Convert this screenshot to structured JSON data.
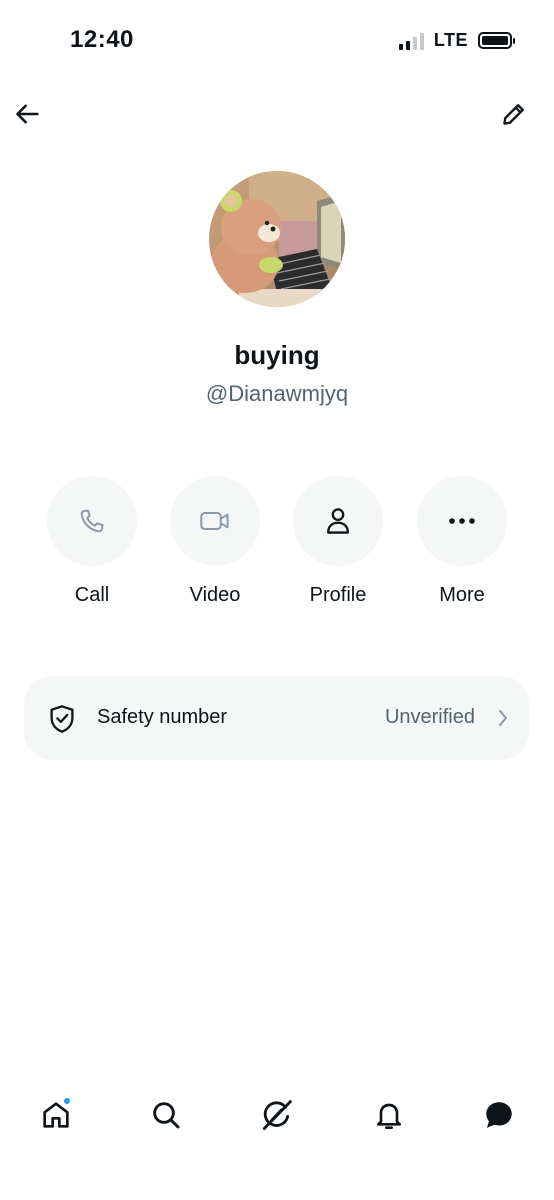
{
  "status_bar": {
    "time": "12:40",
    "network": "LTE"
  },
  "header": {
    "back_icon": "arrow-left-icon",
    "edit_icon": "pencil-icon"
  },
  "profile": {
    "display_name": "buying",
    "handle": "@Dianawmjyq"
  },
  "actions": [
    {
      "label": "Call",
      "icon": "phone-icon"
    },
    {
      "label": "Video",
      "icon": "video-camera-icon"
    },
    {
      "label": "Profile",
      "icon": "person-icon"
    },
    {
      "label": "More",
      "icon": "more-dots-icon"
    }
  ],
  "safety": {
    "label": "Safety number",
    "status": "Unverified"
  },
  "tab_bar": {
    "items": [
      "home-icon",
      "search-icon",
      "grok-icon",
      "bell-icon",
      "messages-icon"
    ],
    "home_has_notification": true
  },
  "colors": {
    "accent": "#1d9bf0",
    "text_primary": "#0f1419",
    "text_secondary": "#536471",
    "surface": "#f5f6f6"
  }
}
